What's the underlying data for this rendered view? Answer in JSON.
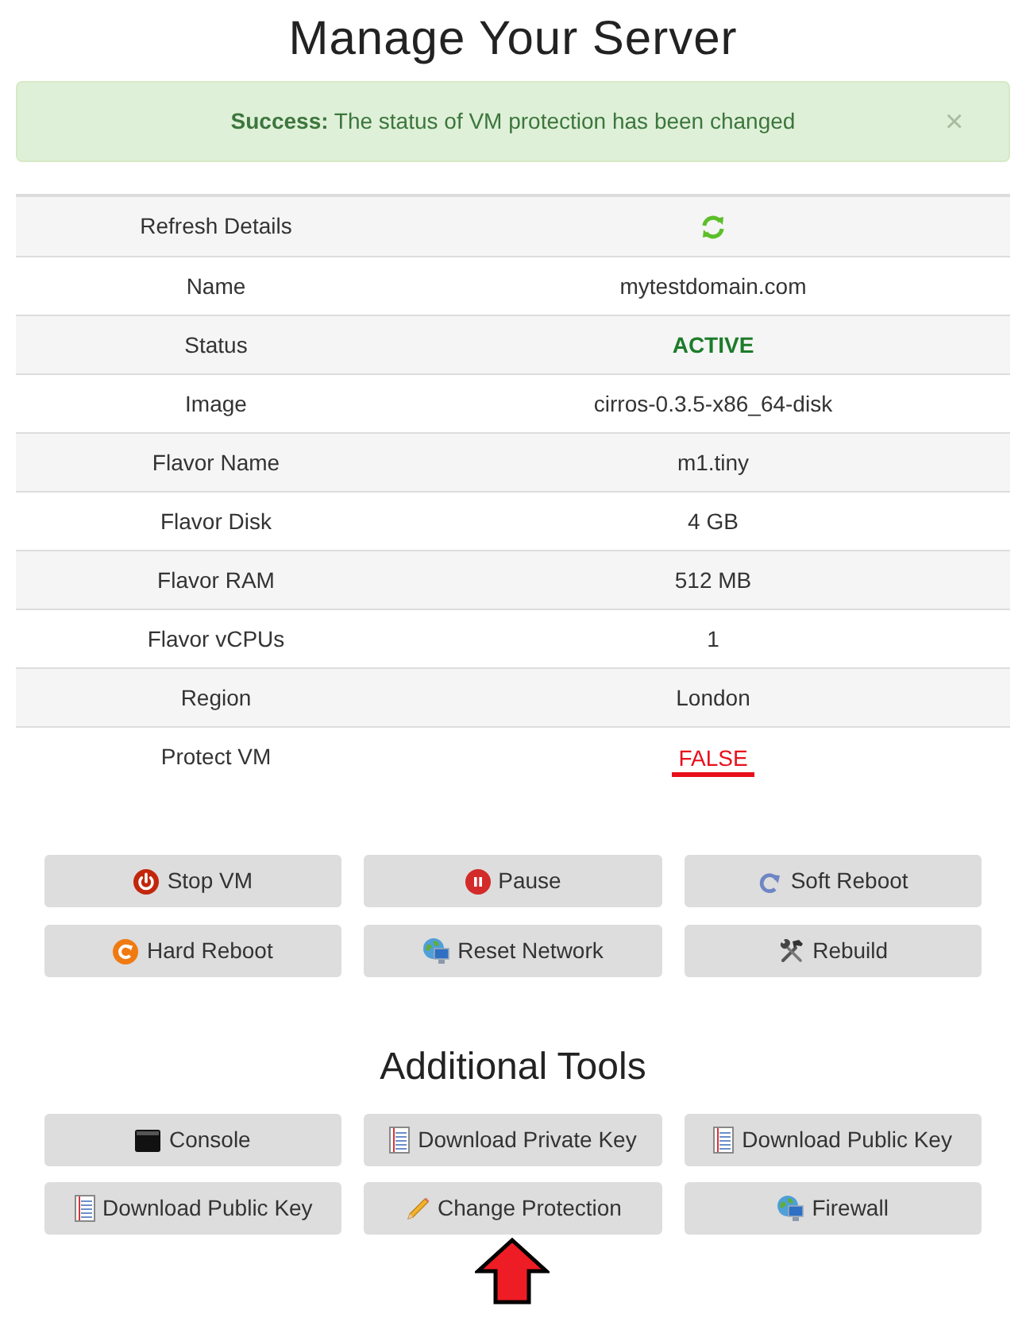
{
  "page": {
    "title": "Manage Your Server"
  },
  "alert": {
    "message": "**Success:** The status of VM protection has been changed",
    "dismiss": "×"
  },
  "details": [
    {
      "label": "Refresh Details",
      "kind": "action"
    },
    {
      "label": "Name",
      "kind": "text",
      "value": "mytestdomain.com"
    },
    {
      "label": "Status",
      "kind": "status",
      "value": "ACTIVE"
    },
    {
      "label": "Image",
      "kind": "text",
      "value": "cirros-0.3.5-x86_64-disk"
    },
    {
      "label": "Flavor Name",
      "kind": "text",
      "value": "m1.tiny"
    },
    {
      "label": "Flavor Disk",
      "kind": "text",
      "value": "4 GB"
    },
    {
      "label": "Flavor RAM",
      "kind": "text",
      "value": "512 MB"
    },
    {
      "label": "Flavor vCPUs",
      "kind": "text",
      "value": "1"
    },
    {
      "label": "Region",
      "kind": "text",
      "value": "London"
    },
    {
      "label": "Protect VM",
      "kind": "flag",
      "value": "FALSE"
    }
  ],
  "actions": [
    {
      "label": "Stop VM",
      "kind": "power"
    },
    {
      "label": "Pause",
      "kind": "pause"
    },
    {
      "label": "Soft Reboot",
      "kind": "redo"
    },
    {
      "label": "Hard Reboot",
      "kind": "restart"
    },
    {
      "label": "Reset Network",
      "kind": "network"
    },
    {
      "label": "Rebuild",
      "kind": "tools"
    }
  ],
  "tools_title": "Additional Tools",
  "tools": [
    {
      "label": "Console",
      "kind": "terminal",
      "marked": false
    },
    {
      "label": "Download Private Key",
      "kind": "notepad",
      "marked": false
    },
    {
      "label": "Download Public Key",
      "kind": "notepad",
      "marked": false
    },
    {
      "label": "Download Public Key",
      "kind": "notepad",
      "marked": false
    },
    {
      "label": "Change Protection",
      "kind": "pencil",
      "marked": true
    },
    {
      "label": "Firewall",
      "kind": "network",
      "marked": false
    }
  ]
}
